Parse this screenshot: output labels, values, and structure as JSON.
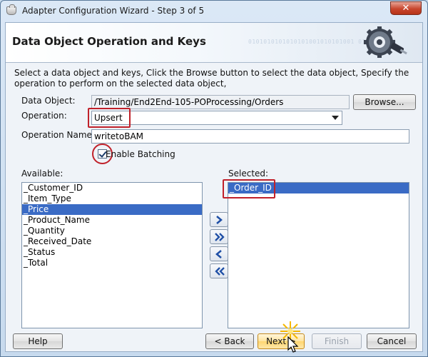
{
  "window": {
    "title": "Adapter Configuration Wizard - Step 3 of 5",
    "close_label": "✕"
  },
  "header": {
    "title": "Data Object Operation and Keys",
    "binary_text": "0101010101010101001010101001 0101011010"
  },
  "instructions": "Select a data object and keys,  Click the Browse button to select the data object,  Specify the operation to perform on the selected data object,",
  "form": {
    "data_object_label": "Data Object:",
    "data_object_value": "/Training/End2End-105-POProcessing/Orders",
    "browse_label": "Browse...",
    "operation_label": "Operation:",
    "operation_value": "Upsert",
    "operation_name_label": "Operation Name:",
    "operation_name_value": "writetoBAM",
    "enable_batching_label": "Enable Batching",
    "enable_batching_checked": true
  },
  "available": {
    "label": "Available:",
    "items": [
      "_Customer_ID",
      "_Item_Type",
      "_Price",
      "_Product_Name",
      "_Quantity",
      "_Received_Date",
      "_Status",
      "_Total"
    ],
    "selected_index": 2
  },
  "selected": {
    "label": "Selected:",
    "items": [
      "_Order_ID"
    ]
  },
  "footer": {
    "help_label": "Help",
    "back_label": "< Back",
    "next_label": "Next >",
    "finish_label": "Finish",
    "cancel_label": "Cancel"
  },
  "colors": {
    "highlight_red": "#c0212a",
    "selection_blue": "#3a6bc5"
  }
}
